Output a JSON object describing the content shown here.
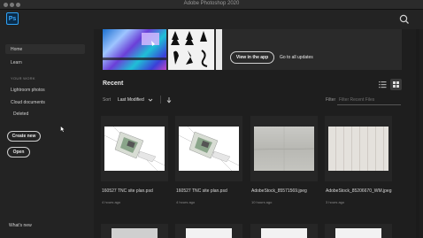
{
  "window": {
    "title": "Adobe Photoshop 2020"
  },
  "app": {
    "logo_text": "Ps",
    "search_icon": "search-icon"
  },
  "sidebar": {
    "home": "Home",
    "learn": "Learn",
    "your_work_caption": "YOUR WORK",
    "lightroom": "Lightroom photos",
    "cloud": "Cloud documents",
    "deleted": "Deleted",
    "create_new": "Create new",
    "open": "Open",
    "whats_new": "What's new"
  },
  "hero": {
    "view_in_app": "View in the app",
    "go_to_updates": "Go to all updates"
  },
  "recent": {
    "title": "Recent",
    "sort_label": "Sort",
    "sort_value": "Last Modified",
    "filter_label": "Filter",
    "filter_placeholder": "Filter Recent Files"
  },
  "files": [
    {
      "name": "160527 TNC site plan.psd",
      "time": "4 hours ago"
    },
    {
      "name": "160527 TNC site plan.psd",
      "time": "4 hours ago"
    },
    {
      "name": "AdobeStock_85571569.jpeg",
      "time": "10 hours ago"
    },
    {
      "name": "AdobeStock_85206670_WM.jpeg",
      "time": "3 hours ago"
    }
  ],
  "colors": {
    "accent": "#2fa3f7",
    "background": "#1e1e1e",
    "sidebar": "#232323"
  }
}
